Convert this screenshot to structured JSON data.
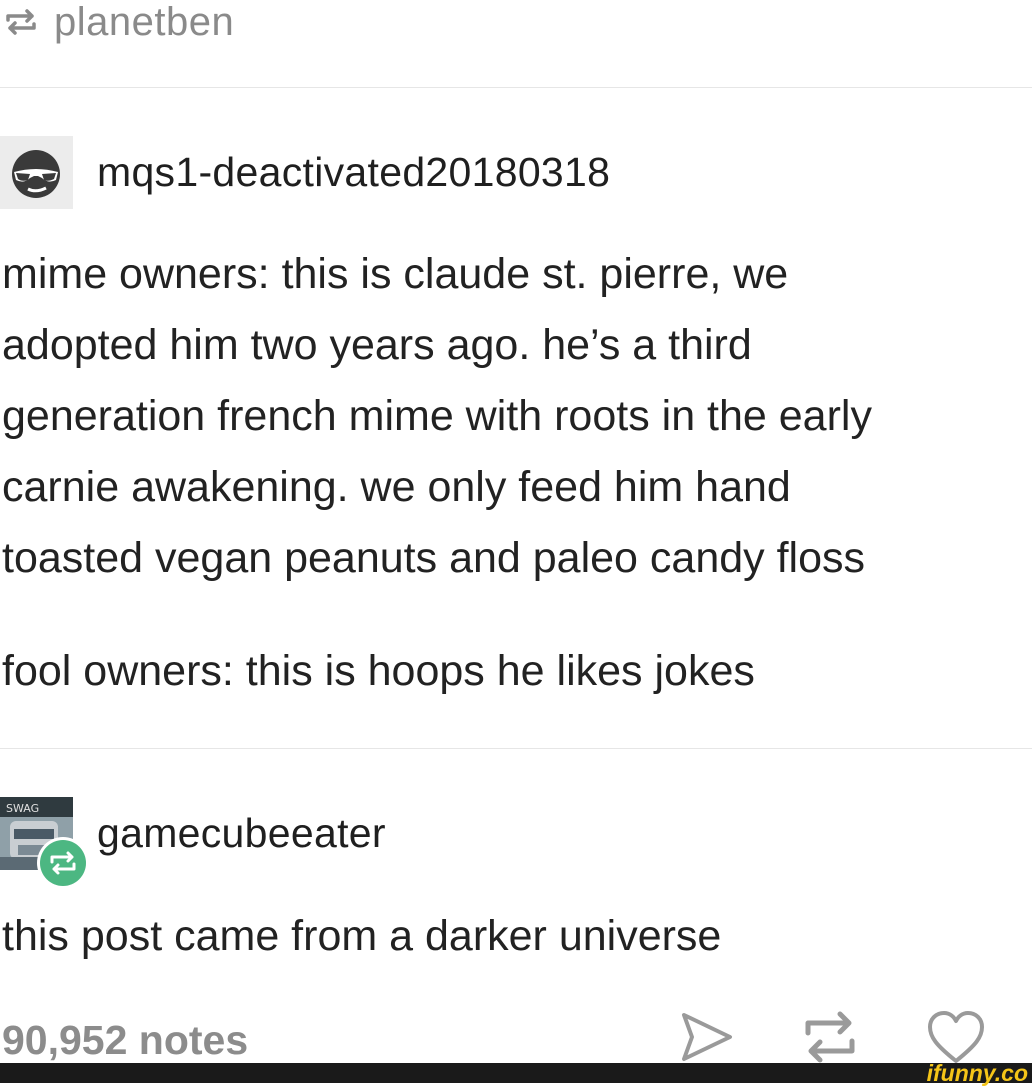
{
  "reblog_header": {
    "icon": "reblog-icon",
    "name": "planetben"
  },
  "post1": {
    "avatar": "sunglasses-face-icon",
    "username": "mqs1-deactivated20180318",
    "lines": [
      "mime owners: this is claude st. pierre, we",
      "adopted him two years ago. he’s a third",
      "generation french mime with roots in the early",
      "carnie awakening. we only feed him hand",
      "toasted vegan peanuts and paleo candy floss"
    ],
    "line2": "fool owners: this is hoops he likes jokes"
  },
  "post2": {
    "avatar": "robot-avatar",
    "username": "gamecubeeater",
    "text": "this post came from a darker universe"
  },
  "footer": {
    "notes": "90,952 notes",
    "icons": [
      "share-icon",
      "reblog-icon",
      "heart-icon"
    ]
  },
  "watermark": "ifunny.co",
  "colors": {
    "reblog_badge": "#4cb782",
    "muted": "#8a8a8a",
    "text": "#222222"
  }
}
